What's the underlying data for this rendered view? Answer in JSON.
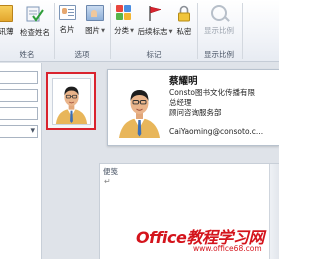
{
  "ribbon": {
    "buttons": {
      "address_book": "讯薄",
      "check_names": "检查姓名",
      "business_card": "名片",
      "picture": "图片",
      "categorize": "分类",
      "follow_up": "后续标志",
      "private": "私密",
      "zoom": "显示比例"
    },
    "groups": {
      "names": "姓名",
      "options": "选项",
      "tags": "标记",
      "zoom": "显示比例"
    }
  },
  "business_card": {
    "name": "蔡耀明",
    "company": "Consto图书文化传播有限",
    "title": "总经理",
    "department": "顾问咨询服务部",
    "email": "CaiYaoming@consoto.c..."
  },
  "notes": {
    "label": "便笺",
    "cursor": "↵"
  },
  "watermark": {
    "main": "Office教程学习网",
    "url": "www.office68.com"
  },
  "colors": {
    "photo_highlight": "#d9232e",
    "watermark": "#d4141c"
  }
}
